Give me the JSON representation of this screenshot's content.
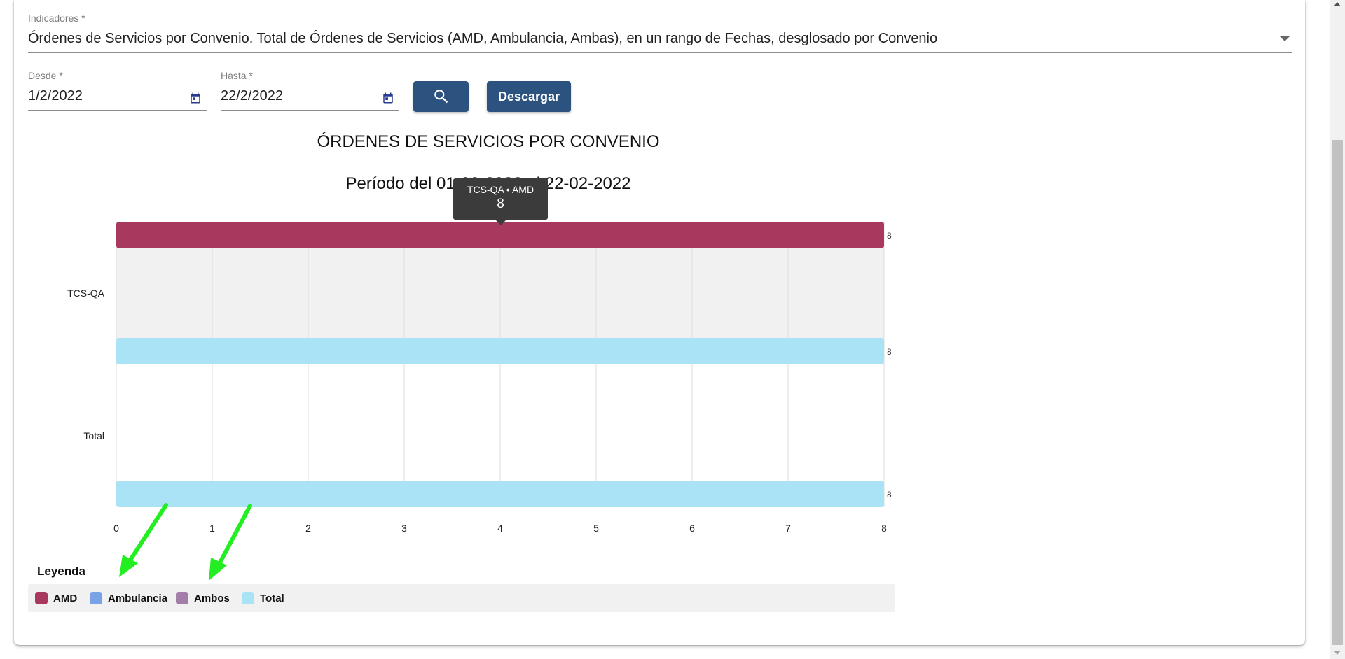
{
  "indicator": {
    "label": "Indicadores *",
    "value": "Órdenes de Servicios por Convenio. Total de Órdenes de Servicios (AMD, Ambulancia, Ambas), en un rango de Fechas, desglosado por Convenio"
  },
  "date_from": {
    "label": "Desde *",
    "value": "1/2/2022"
  },
  "date_to": {
    "label": "Hasta *",
    "value": "22/2/2022"
  },
  "buttons": {
    "search_icon": "search-icon",
    "download_label": "Descargar"
  },
  "colors": {
    "button": "#2c5280",
    "AMD": "#a8385d",
    "Ambulancia": "#7aa3e5",
    "Ambos": "#a27ea8",
    "Total": "#aae3f5",
    "arrow": "#22ee22"
  },
  "chart": {
    "title": "ÓRDENES DE SERVICIOS POR CONVENIO",
    "subtitle": "Período del 01-02-2022 al 22-02-2022"
  },
  "chart_data": {
    "type": "bar",
    "orientation": "horizontal",
    "categories": [
      "TCS-QA",
      "Total"
    ],
    "series": [
      {
        "name": "AMD",
        "values": [
          8,
          null
        ]
      },
      {
        "name": "Ambulancia",
        "values": [
          null,
          null
        ]
      },
      {
        "name": "Ambos",
        "values": [
          null,
          null
        ]
      },
      {
        "name": "Total",
        "values": [
          8,
          8
        ]
      }
    ],
    "data_labels": true,
    "xlim": [
      0,
      8
    ],
    "x_ticks": [
      0,
      1,
      2,
      3,
      4,
      5,
      6,
      7,
      8
    ],
    "grid": true,
    "legend_position": "bottom"
  },
  "tooltip": {
    "title": "TCS-QA • AMD",
    "value": "8"
  },
  "legend": {
    "title": "Leyenda",
    "items": [
      "AMD",
      "Ambulancia",
      "Ambos",
      "Total"
    ]
  }
}
